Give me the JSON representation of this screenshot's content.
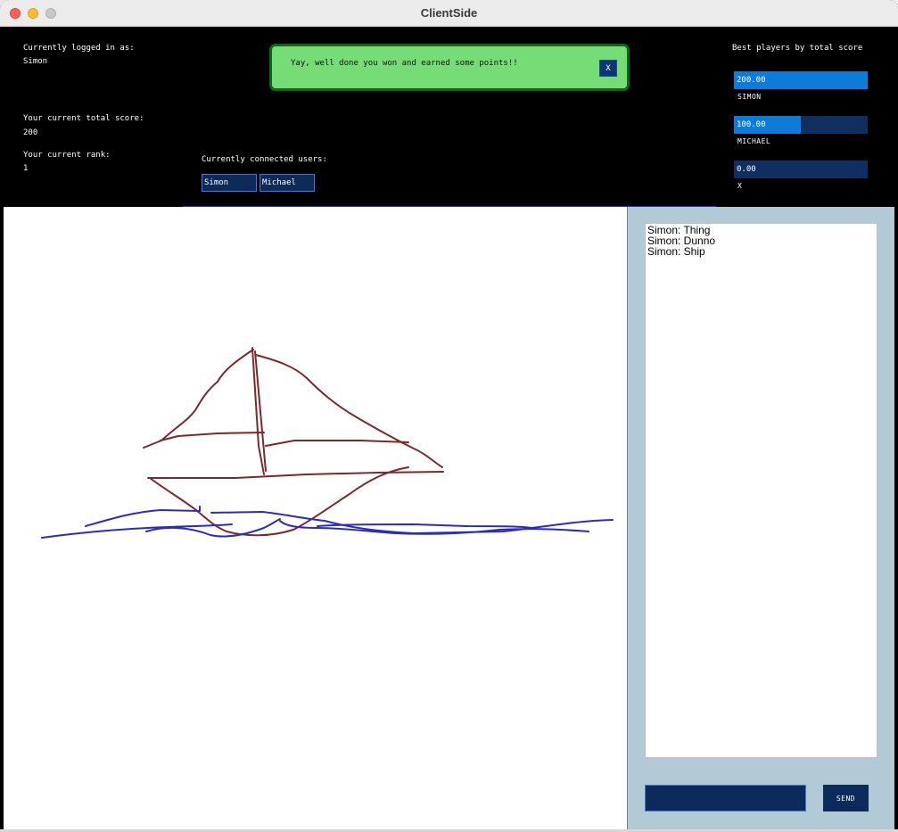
{
  "window": {
    "title": "ClientSide"
  },
  "account": {
    "logged_in_label": "Currently logged in as:",
    "username": "Simon",
    "total_score_label": "Your current total score:",
    "total_score": "200",
    "rank_label": "Your current rank:",
    "rank": "1"
  },
  "notification": {
    "message": "Yay, well done you won and earned some points!!",
    "close_label": "X"
  },
  "connected": {
    "label": "Currently connected users:",
    "users": [
      "Simon",
      "Michael"
    ]
  },
  "leaderboard": {
    "title": "Best players by total score",
    "players": [
      {
        "score": "200.00",
        "name": "SIMON",
        "fill": 1.0
      },
      {
        "score": "100.00",
        "name": "MICHAEL",
        "fill": 0.5
      },
      {
        "score": "0.00",
        "name": "X",
        "fill": 0.0
      }
    ]
  },
  "chat": {
    "messages": [
      "Simon: Thing",
      "Simon: Dunno",
      "Simon: Ship"
    ],
    "input_value": "",
    "send_label": "SEND"
  },
  "drawing": {
    "colors": {
      "boat": "#7b2a2a",
      "water": "#2b2bc0"
    }
  }
}
